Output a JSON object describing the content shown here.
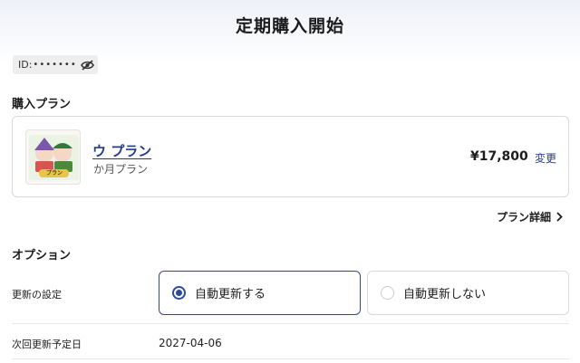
{
  "header": {
    "title": "定期購入開始"
  },
  "account": {
    "id_label": "ID:",
    "id_masked": "•••••••",
    "toggle_icon": "eye-off-icon"
  },
  "purchase_plan": {
    "heading": "購入プラン",
    "plan_name": "ウ プラン",
    "plan_duration": "か月プラン",
    "price": "¥17,800",
    "change_label": "変更",
    "thumbnail_caption": "プラン",
    "detail_link": "プラン詳細"
  },
  "options": {
    "heading": "オプション",
    "renewal_label": "更新の設定",
    "choices": [
      "自動更新する",
      "自動更新しない"
    ],
    "selected_choice": "自動更新する",
    "next_renewal_label": "次回更新予定日",
    "next_renewal_date": "2027-04-06"
  },
  "colors": {
    "accent": "#2c4a9a",
    "link": "#243b8c",
    "border": "#d9d9d9"
  }
}
